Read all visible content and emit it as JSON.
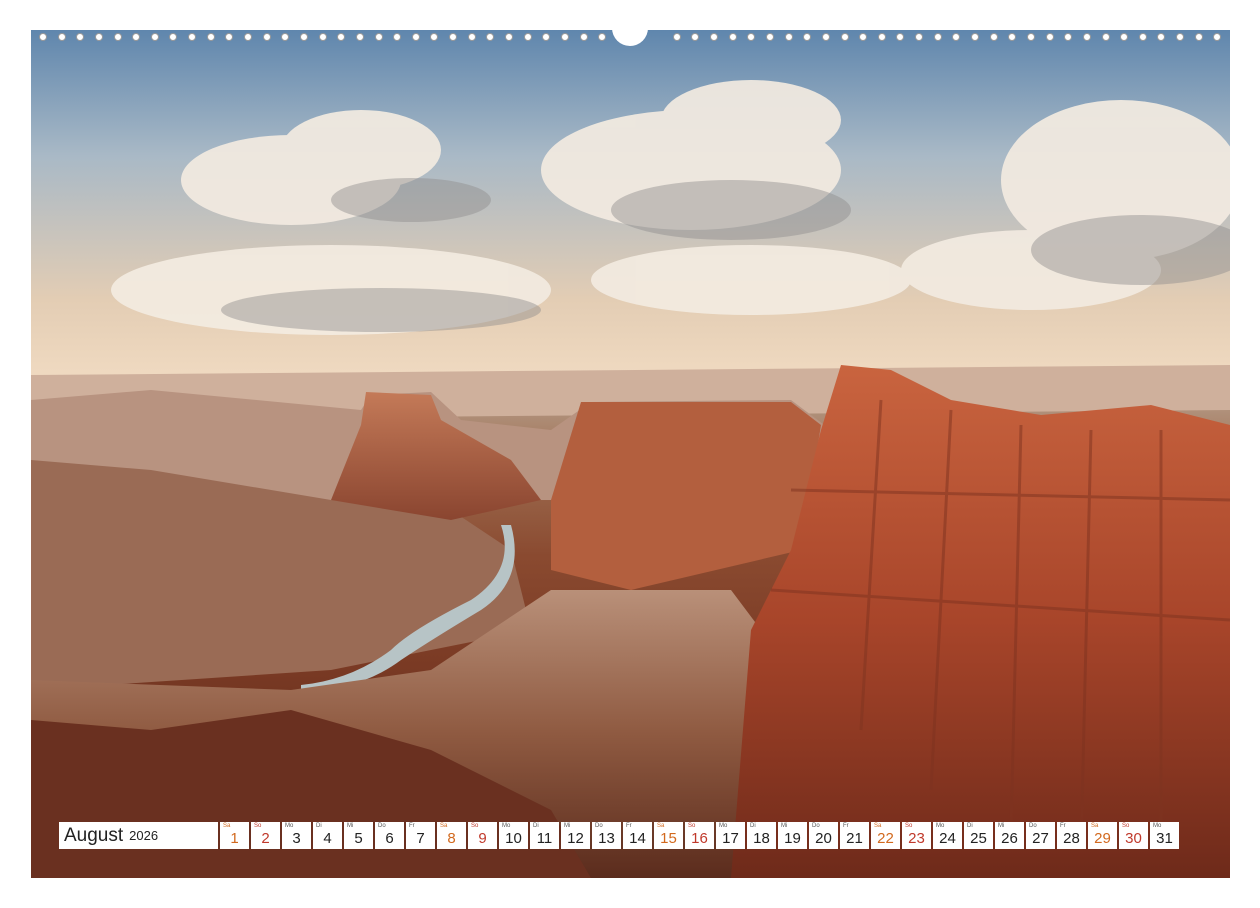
{
  "calendar": {
    "month": "August",
    "year": "2026",
    "days": [
      {
        "wd": "Sa",
        "num": "1",
        "type": "sat"
      },
      {
        "wd": "So",
        "num": "2",
        "type": "sun"
      },
      {
        "wd": "Mo",
        "num": "3",
        "type": "wk"
      },
      {
        "wd": "Di",
        "num": "4",
        "type": "wk"
      },
      {
        "wd": "Mi",
        "num": "5",
        "type": "wk"
      },
      {
        "wd": "Do",
        "num": "6",
        "type": "wk"
      },
      {
        "wd": "Fr",
        "num": "7",
        "type": "wk"
      },
      {
        "wd": "Sa",
        "num": "8",
        "type": "sat"
      },
      {
        "wd": "So",
        "num": "9",
        "type": "sun"
      },
      {
        "wd": "Mo",
        "num": "10",
        "type": "wk"
      },
      {
        "wd": "Di",
        "num": "11",
        "type": "wk"
      },
      {
        "wd": "Mi",
        "num": "12",
        "type": "wk"
      },
      {
        "wd": "Do",
        "num": "13",
        "type": "wk"
      },
      {
        "wd": "Fr",
        "num": "14",
        "type": "wk"
      },
      {
        "wd": "Sa",
        "num": "15",
        "type": "sat"
      },
      {
        "wd": "So",
        "num": "16",
        "type": "sun"
      },
      {
        "wd": "Mo",
        "num": "17",
        "type": "wk"
      },
      {
        "wd": "Di",
        "num": "18",
        "type": "wk"
      },
      {
        "wd": "Mi",
        "num": "19",
        "type": "wk"
      },
      {
        "wd": "Do",
        "num": "20",
        "type": "wk"
      },
      {
        "wd": "Fr",
        "num": "21",
        "type": "wk"
      },
      {
        "wd": "Sa",
        "num": "22",
        "type": "sat"
      },
      {
        "wd": "So",
        "num": "23",
        "type": "sun"
      },
      {
        "wd": "Mo",
        "num": "24",
        "type": "wk"
      },
      {
        "wd": "Di",
        "num": "25",
        "type": "wk"
      },
      {
        "wd": "Mi",
        "num": "26",
        "type": "wk"
      },
      {
        "wd": "Do",
        "num": "27",
        "type": "wk"
      },
      {
        "wd": "Fr",
        "num": "28",
        "type": "wk"
      },
      {
        "wd": "Sa",
        "num": "29",
        "type": "sat"
      },
      {
        "wd": "So",
        "num": "30",
        "type": "sun"
      },
      {
        "wd": "Mo",
        "num": "31",
        "type": "wk"
      }
    ]
  },
  "colors": {
    "saturday": "#d2691e",
    "sunday": "#c0392b"
  }
}
